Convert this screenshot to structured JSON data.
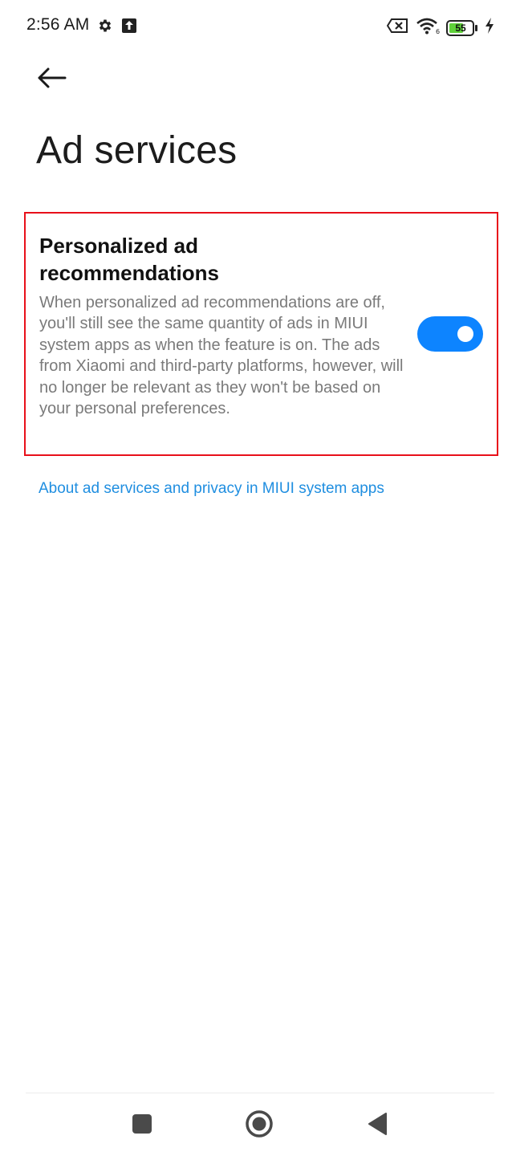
{
  "status_bar": {
    "time": "2:56 AM",
    "battery_level": "55",
    "icons": [
      "gear-icon",
      "upload-icon",
      "no-sim-icon",
      "wifi-icon",
      "battery-icon",
      "charging-bolt-icon"
    ]
  },
  "header": {
    "back_icon": "arrow-left-icon",
    "title": "Ad services"
  },
  "setting": {
    "title": "Personalized ad recommendations",
    "description": "When personalized ad recommendations are off, you'll still see the same quantity of ads in MIUI system apps as when the feature is on. The ads from Xiaomi and third-party platforms, however, will no longer be relevant as they won't be based on your personal preferences.",
    "toggle_on": true
  },
  "link": {
    "text": "About ad services and privacy in MIUI system apps"
  },
  "nav_bar": {
    "icons": [
      "recents-square-icon",
      "home-circle-icon",
      "back-triangle-icon"
    ]
  },
  "colors": {
    "accent": "#0d84ff",
    "link": "#1f8ee0",
    "highlight_border": "#e8101a",
    "description_text": "#7a7a7a"
  }
}
